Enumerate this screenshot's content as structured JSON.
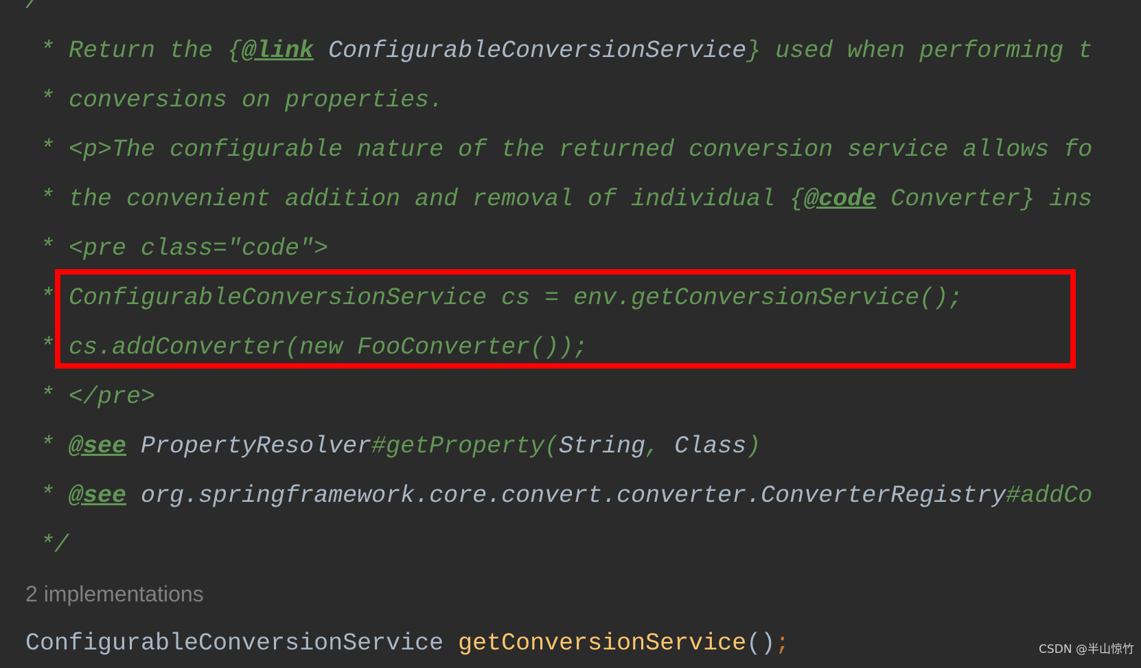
{
  "colors": {
    "background": "#2b2b2b",
    "comment": "#629755",
    "reference": "#a9b7c6",
    "method": "#ffc66d",
    "keyword": "#cc7832",
    "highlight_box": "#ff0000"
  },
  "doc_comment": [
    [
      {
        "t": "/**",
        "s": "c"
      }
    ],
    [
      {
        "t": " * Return the {",
        "s": "c"
      },
      {
        "t": "@link",
        "s": "tag"
      },
      {
        "t": " ConfigurableConversionService",
        "s": "ref"
      },
      {
        "t": "} used when performing t",
        "s": "c"
      }
    ],
    [
      {
        "t": " * conversions on properties.",
        "s": "c"
      }
    ],
    [
      {
        "t": " * <p>The configurable nature of the returned conversion service allows fo",
        "s": "c"
      }
    ],
    [
      {
        "t": " * the convenient addition and removal of individual {",
        "s": "c"
      },
      {
        "t": "@code",
        "s": "tag"
      },
      {
        "t": " Converter",
        "s": "c"
      },
      {
        "t": "} ins",
        "s": "c"
      }
    ],
    [
      {
        "t": " * <pre class=\"code\">",
        "s": "c"
      }
    ],
    [
      {
        "t": " * ConfigurableConversionService cs = env.getConversionService();",
        "s": "c"
      }
    ],
    [
      {
        "t": " * cs.addConverter(new FooConverter());",
        "s": "c"
      }
    ],
    [
      {
        "t": " * </pre>",
        "s": "c"
      }
    ],
    [
      {
        "t": " * ",
        "s": "c"
      },
      {
        "t": "@see",
        "s": "tag"
      },
      {
        "t": " PropertyResolver",
        "s": "ref"
      },
      {
        "t": "#getProperty(",
        "s": "c"
      },
      {
        "t": "String",
        "s": "ref"
      },
      {
        "t": ", ",
        "s": "c"
      },
      {
        "t": "Class",
        "s": "ref"
      },
      {
        "t": ")",
        "s": "c"
      }
    ],
    [
      {
        "t": " * ",
        "s": "c"
      },
      {
        "t": "@see",
        "s": "tag"
      },
      {
        "t": " org.springframework.core.convert.converter.ConverterRegistry",
        "s": "ref"
      },
      {
        "t": "#addCo",
        "s": "c"
      }
    ],
    [
      {
        "t": " */",
        "s": "c"
      }
    ]
  ],
  "implementations_hint": "2 implementations",
  "declaration": {
    "return_type": "ConfigurableConversionService",
    "method_name": "getConversionService",
    "parens": "()",
    "semicolon": ";"
  },
  "watermark": "CSDN @半山惊竹"
}
